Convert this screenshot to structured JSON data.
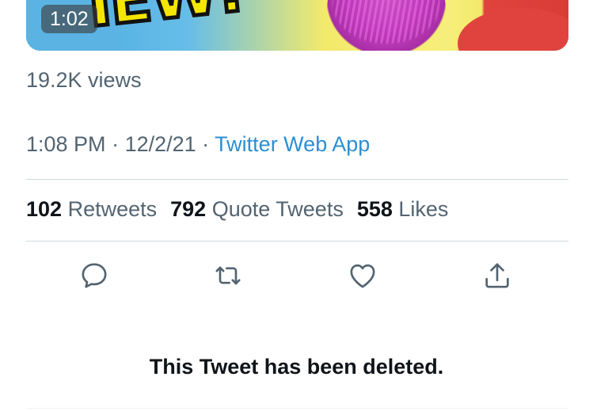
{
  "video": {
    "duration": "1:02",
    "thumbnail_text": "IEW!"
  },
  "views": "19.2K views",
  "meta": {
    "time": "1:08 PM",
    "separator1": " · ",
    "date": "12/2/21",
    "separator2": " · ",
    "source": "Twitter Web App"
  },
  "stats": {
    "retweets_count": "102",
    "retweets_label": "Retweets",
    "quotes_count": "792",
    "quotes_label": "Quote Tweets",
    "likes_count": "558",
    "likes_label": "Likes"
  },
  "actions": {
    "reply_icon": "reply-icon",
    "retweet_icon": "retweet-icon",
    "like_icon": "heart-icon",
    "share_icon": "share-icon"
  },
  "colors": {
    "secondary_text": "#536471",
    "link": "#2b8fd3",
    "primary_text": "#0f1419",
    "divider": "#cfd9de"
  },
  "notice": "This Tweet has been deleted."
}
